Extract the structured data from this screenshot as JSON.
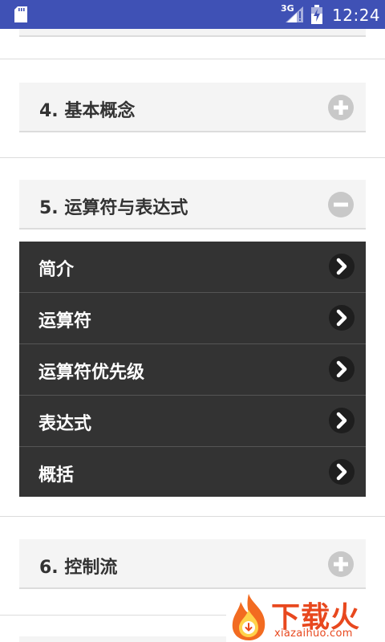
{
  "status_bar": {
    "network": "3G",
    "time": "12:24"
  },
  "sections": [
    {
      "title": "4. 基本概念",
      "state": "collapsed",
      "icon": "plus-icon"
    },
    {
      "title": "5. 运算符与表达式",
      "state": "expanded",
      "icon": "minus-icon",
      "items": [
        "简介",
        "运算符",
        "运算符优先级",
        "表达式",
        "概括"
      ]
    },
    {
      "title": "6. 控制流",
      "state": "collapsed",
      "icon": "plus-icon"
    }
  ],
  "watermark": {
    "text": "下载火",
    "url": "xiazaihuo.com"
  },
  "colors": {
    "status_bar": "#3f51b5",
    "header_bg": "#f4f4f4",
    "submenu_bg": "#333333",
    "icon_gray": "#c8c8c8",
    "watermark": "#e8481e"
  }
}
